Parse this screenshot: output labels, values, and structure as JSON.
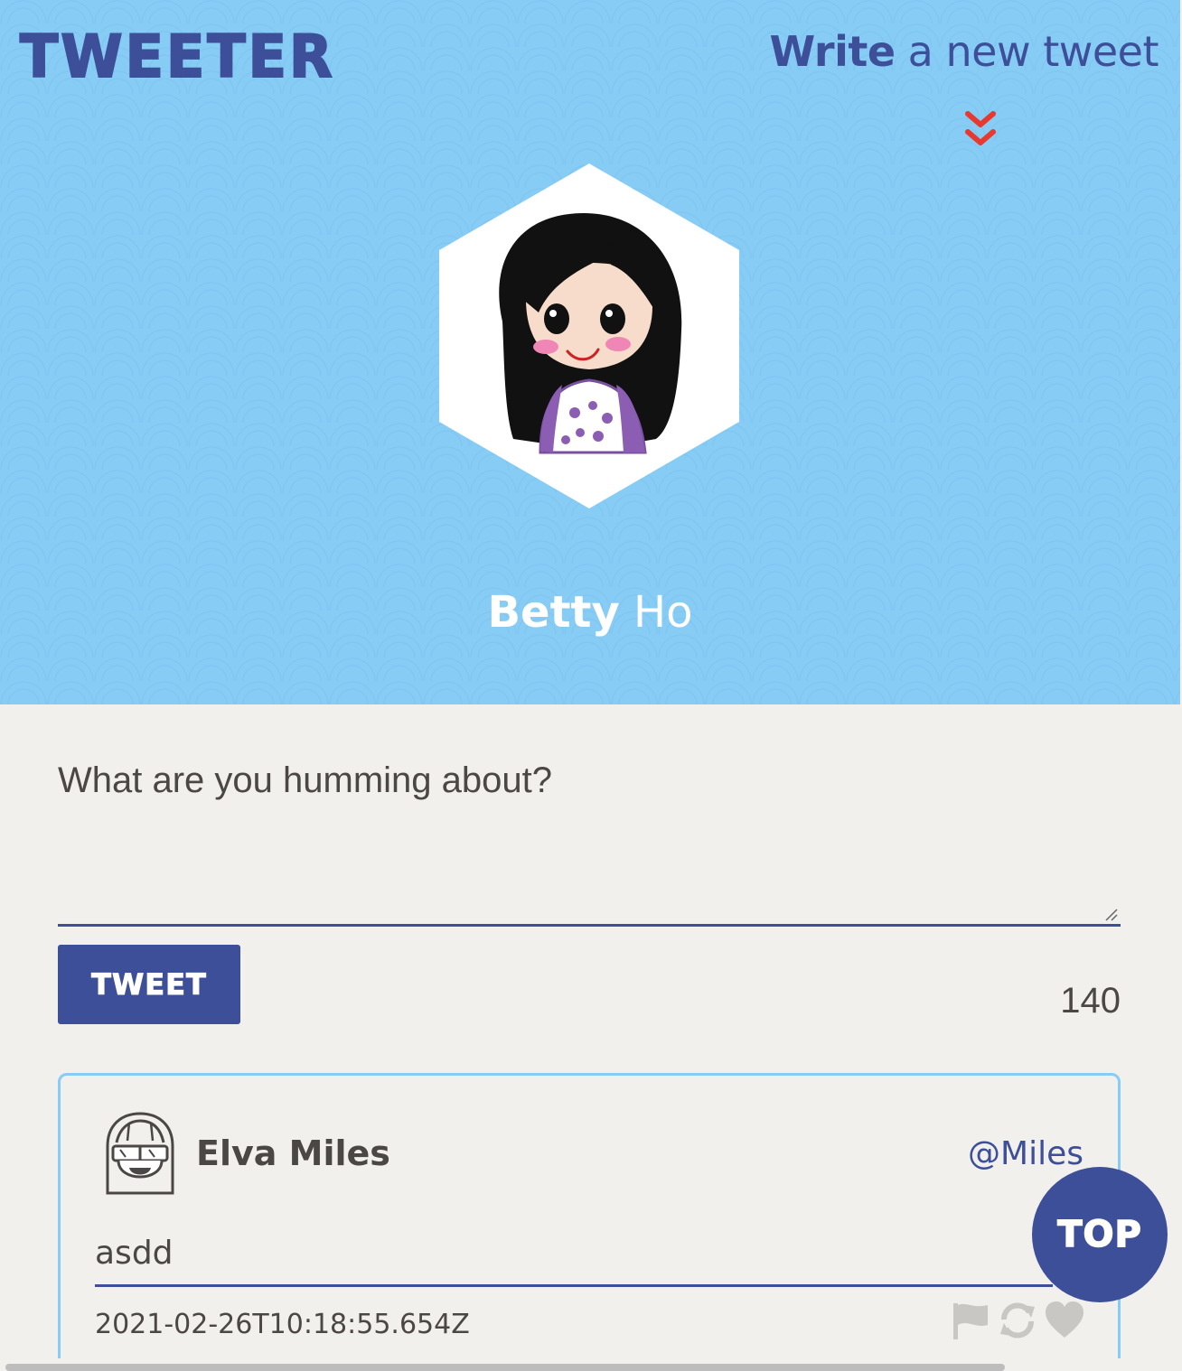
{
  "app": {
    "logo": "TWEETER",
    "nav": {
      "write_bold": "Write",
      "write_rest": " a new tweet"
    }
  },
  "profile": {
    "first_name": "Betty",
    "last_name": " Ho"
  },
  "compose": {
    "placeholder": "What are you humming about?",
    "button_label": "TWEET",
    "char_count": "140"
  },
  "tweets": [
    {
      "name": "Elva Miles",
      "handle": "@Miles",
      "text": "asdd",
      "timestamp": "2021-02-26T10:18:55.654Z",
      "actions": [
        "flag-icon",
        "retweet-icon",
        "heart-icon"
      ]
    }
  ],
  "top_button_label": "TOP",
  "colors": {
    "header_bg": "#87ccf5",
    "brand": "#3d4f98",
    "page_bg": "#f2f0ec",
    "accent_chevron": "#e8392f",
    "text": "#4a4744",
    "icon_muted": "#c9c7c3"
  }
}
